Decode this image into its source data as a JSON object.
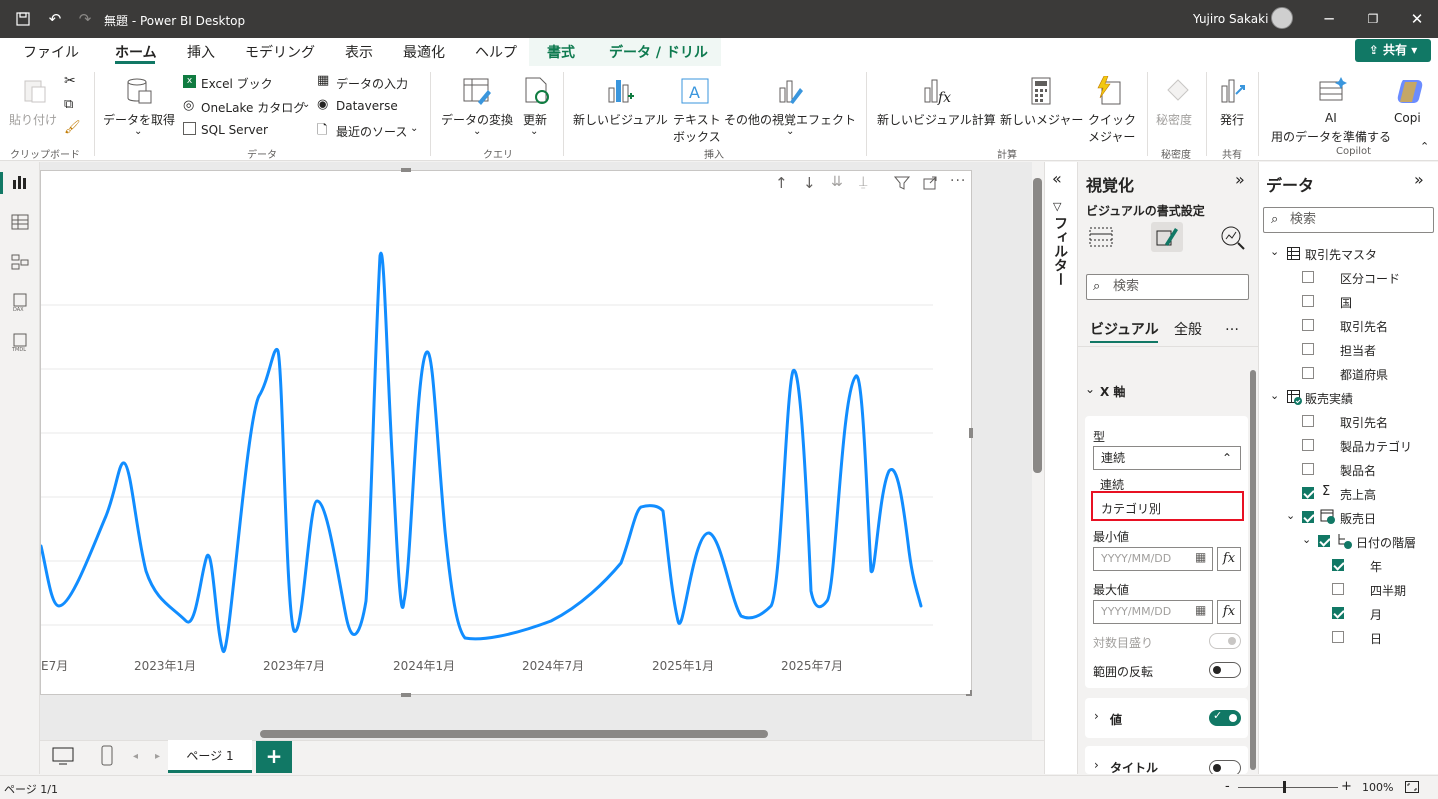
{
  "titlebar": {
    "title": "無題 - Power BI Desktop",
    "user": "Yujiro Sakaki"
  },
  "menu": {
    "tabs": [
      {
        "label": "ファイル"
      },
      {
        "label": "ホーム"
      },
      {
        "label": "挿入"
      },
      {
        "label": "モデリング"
      },
      {
        "label": "表示"
      },
      {
        "label": "最適化"
      },
      {
        "label": "ヘルプ"
      },
      {
        "label": "書式"
      },
      {
        "label": "データ / ドリル"
      }
    ],
    "share": "共有"
  },
  "ribbon": {
    "paste": "貼り付け",
    "clipboard_group": "クリップボード",
    "get_data": "データを取得",
    "excel": "Excel ブック",
    "onelake": "OneLake カタログ",
    "sql": "SQL Server",
    "enter_data": "データの入力",
    "dataverse": "Dataverse",
    "recent": "最近のソース",
    "data_group": "データ",
    "transform": "データの変換",
    "refresh": "更新",
    "query_group": "クエリ",
    "new_visual": "新しいビジュアル",
    "textbox_1": "テキスト",
    "textbox_2": "ボックス",
    "more_visuals": "その他の視覚エフェクト",
    "insert_group": "挿入",
    "new_visual_calc": "新しいビジュアル計算",
    "new_measure": "新しいメジャー",
    "quick_measure_1": "クイック",
    "quick_measure_2": "メジャー",
    "calc_group": "計算",
    "sensitivity": "秘密度",
    "sensitivity_group": "秘密度",
    "publish": "発行",
    "share_group": "共有",
    "ai_1": "AI",
    "ai_2": "用のデータを準備する",
    "copilot": "Copi",
    "copilot_group": "Copilot"
  },
  "chart_data": {
    "type": "line",
    "x_tick_labels": [
      "E7月",
      "2023年1月",
      "2023年7月",
      "2024年1月",
      "2024年7月",
      "2025年1月",
      "2025年7月"
    ],
    "line_color": "#118dff",
    "grid": true
  },
  "filters": {
    "label": "フィルター"
  },
  "viz": {
    "title": "視覚化",
    "format_title": "ビジュアルの書式設定",
    "search_placeholder": "検索",
    "tab_visual": "ビジュアル",
    "tab_general": "全般",
    "more": "…",
    "xaxis": "X 軸",
    "type_label": "型",
    "type_value": "連続",
    "options": [
      "連続",
      "カテゴリ別"
    ],
    "min_label": "最小値",
    "min_placeholder": "YYYY/MM/DD",
    "max_label": "最大値",
    "max_placeholder": "YYYY/MM/DD",
    "log_label": "対数目盛り",
    "reverse_label": "範囲の反転",
    "values_label": "値",
    "title_label": "タイトル"
  },
  "data": {
    "title": "データ",
    "search_placeholder": "検索",
    "tables": [
      {
        "name": "取引先マスタ",
        "fields": [
          "区分コード",
          "国",
          "取引先名",
          "担当者",
          "都道府県"
        ]
      },
      {
        "name": "販売実績",
        "fields": [
          "取引先名",
          "製品カテゴリ",
          "製品名",
          "売上高",
          "販売日",
          "日付の階層",
          "年",
          "四半期",
          "月",
          "日"
        ]
      }
    ]
  },
  "pages": {
    "tab": "ページ 1"
  },
  "status": {
    "page": "ページ 1/1",
    "zoom": "100%"
  },
  "colors": {
    "accent": "#117865",
    "highlight_box": "#e81123",
    "line": "#118dff"
  }
}
